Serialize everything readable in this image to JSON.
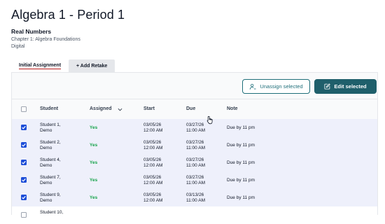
{
  "page": {
    "title": "Algebra 1 - Period 1"
  },
  "lesson": {
    "title": "Real Numbers",
    "chapter": "Chapter 1: Algebra Foundations",
    "type": "Digital"
  },
  "tabs": [
    {
      "label": "Initial Assignment",
      "active": true
    },
    {
      "label": "+ Add Retake",
      "active": false
    }
  ],
  "actions": {
    "unassign_label": "Unassign selected",
    "edit_label": "Edit selected"
  },
  "table": {
    "columns": {
      "student": "Student",
      "assigned": "Assigned",
      "start": "Start",
      "due": "Due",
      "note": "Note"
    },
    "rows": [
      {
        "student": [
          "Student 1,",
          "Demo"
        ],
        "assigned": "Yes",
        "start": [
          "03/05/26",
          "12:00 AM"
        ],
        "due": [
          "03/27/26",
          "11:00 AM"
        ],
        "note": "Due by 11 pm",
        "checked": true
      },
      {
        "student": [
          "Student 2,",
          "Demo"
        ],
        "assigned": "Yes",
        "start": [
          "03/05/26",
          "12:00 AM"
        ],
        "due": [
          "03/27/26",
          "11:00 AM"
        ],
        "note": "Due by 11 pm",
        "checked": true
      },
      {
        "student": [
          "Student 4,",
          "Demo"
        ],
        "assigned": "Yes",
        "start": [
          "03/05/26",
          "12:00 AM"
        ],
        "due": [
          "03/27/26",
          "11:00 AM"
        ],
        "note": "Due by 11 pm",
        "checked": true
      },
      {
        "student": [
          "Student 7,",
          "Demo"
        ],
        "assigned": "Yes",
        "start": [
          "03/05/26",
          "12:00 AM"
        ],
        "due": [
          "03/27/26",
          "11:00 AM"
        ],
        "note": "Due by 11 pm",
        "checked": true
      },
      {
        "student": [
          "Student 9,",
          "Demo"
        ],
        "assigned": "Yes",
        "start": [
          "03/05/26",
          "12:00 AM"
        ],
        "due": [
          "03/13/26",
          "11:00 AM"
        ],
        "note": "Due by 11 pm",
        "checked": true
      },
      {
        "student": [
          "Student 10,",
          ""
        ],
        "assigned": "",
        "start": [
          "",
          ""
        ],
        "due": [
          "",
          ""
        ],
        "note": "",
        "checked": false
      }
    ]
  },
  "colors": {
    "primary": "#1f5f6b",
    "assigned_yes": "#16a34a",
    "checkbox": "#1d4ed8",
    "selected_row": "#eef0fb"
  }
}
